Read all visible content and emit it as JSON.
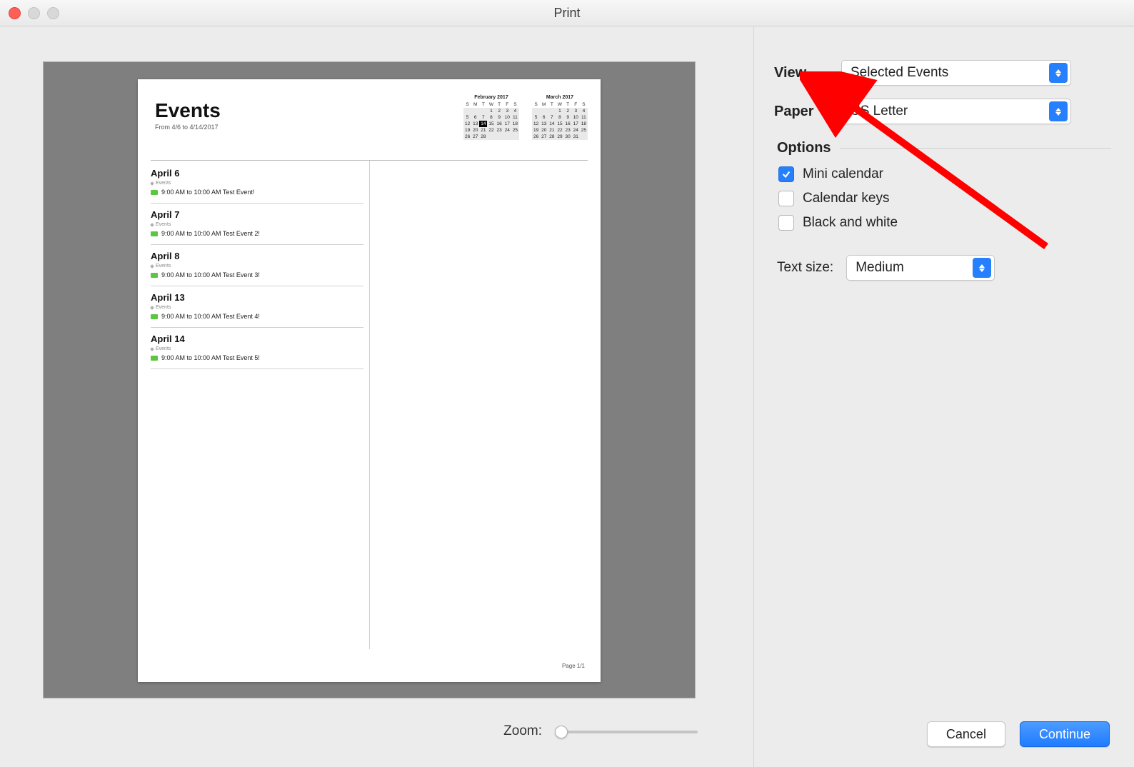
{
  "window": {
    "title": "Print"
  },
  "preview": {
    "title": "Events",
    "range": "From 4/6 to 4/14/2017",
    "footer": "Page 1/1",
    "miniCalendars": [
      {
        "title": "February 2017",
        "dow": [
          "S",
          "M",
          "T",
          "W",
          "T",
          "F",
          "S"
        ],
        "rows": [
          [
            "",
            "",
            "",
            "1",
            "2",
            "3",
            "4"
          ],
          [
            "5",
            "6",
            "7",
            "8",
            "9",
            "10",
            "11"
          ],
          [
            "12",
            "13",
            "14",
            "15",
            "16",
            "17",
            "18"
          ],
          [
            "19",
            "20",
            "21",
            "22",
            "23",
            "24",
            "25"
          ],
          [
            "26",
            "27",
            "28",
            "",
            "",
            "",
            ""
          ]
        ],
        "today": "14"
      },
      {
        "title": "March 2017",
        "dow": [
          "S",
          "M",
          "T",
          "W",
          "T",
          "F",
          "S"
        ],
        "rows": [
          [
            "",
            "",
            "",
            "1",
            "2",
            "3",
            "4"
          ],
          [
            "5",
            "6",
            "7",
            "8",
            "9",
            "10",
            "11"
          ],
          [
            "12",
            "13",
            "14",
            "15",
            "16",
            "17",
            "18"
          ],
          [
            "19",
            "20",
            "21",
            "22",
            "23",
            "24",
            "25"
          ],
          [
            "26",
            "27",
            "28",
            "29",
            "30",
            "31",
            ""
          ]
        ],
        "today": ""
      }
    ],
    "days": [
      {
        "date": "April 6",
        "group": "Events",
        "line": "9:00 AM to 10:00 AM Test Event!"
      },
      {
        "date": "April 7",
        "group": "Events",
        "line": "9:00 AM to 10:00 AM Test Event 2!"
      },
      {
        "date": "April 8",
        "group": "Events",
        "line": "9:00 AM to 10:00 AM Test Event 3!"
      },
      {
        "date": "April 13",
        "group": "Events",
        "line": "9:00 AM to 10:00 AM Test Event 4!"
      },
      {
        "date": "April 14",
        "group": "Events",
        "line": "9:00 AM to 10:00 AM Test Event 5!"
      }
    ]
  },
  "controls": {
    "viewLabel": "View",
    "viewValue": "Selected Events",
    "paperLabel": "Paper",
    "paperValue": "US Letter",
    "optionsHeader": "Options",
    "checkboxes": [
      {
        "label": "Mini calendar",
        "checked": true
      },
      {
        "label": "Calendar keys",
        "checked": false
      },
      {
        "label": "Black and white",
        "checked": false
      }
    ],
    "textSizeLabel": "Text size:",
    "textSizeValue": "Medium"
  },
  "zoom": {
    "label": "Zoom:"
  },
  "buttons": {
    "cancel": "Cancel",
    "continue": "Continue"
  }
}
